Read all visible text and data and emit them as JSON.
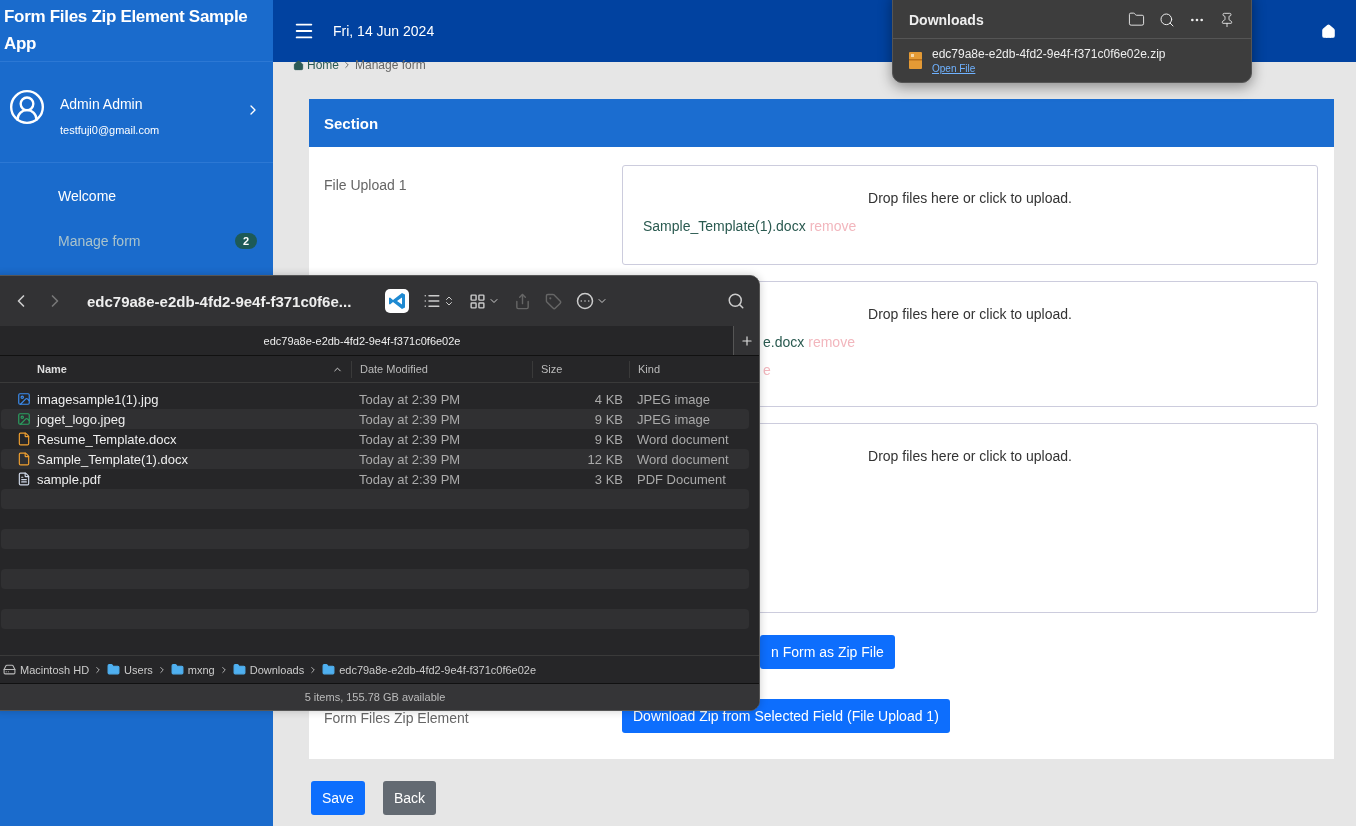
{
  "app": {
    "title": "Form Files Zip Element Sample App"
  },
  "topbar": {
    "date": "Fri, 14 Jun 2024"
  },
  "user": {
    "name": "Admin Admin",
    "email": "testfuji0@gmail.com"
  },
  "nav": [
    {
      "label": "Welcome",
      "selected": false
    },
    {
      "label": "Manage form",
      "selected": true,
      "badge": "2"
    }
  ],
  "breadcrumb": [
    "Home",
    "Manage form"
  ],
  "section": {
    "title": "Section",
    "fields": [
      {
        "kind": "upload",
        "label": "File Upload 1",
        "covered": false,
        "hint": "Drop files here or click to upload.",
        "files": [
          {
            "name": "Sample_Template(1).docx",
            "action": "remove"
          }
        ]
      },
      {
        "kind": "upload",
        "covered": true,
        "hint": "Drop files here or click to upload.",
        "files": [
          {
            "name": "e.docx",
            "action": "remove"
          },
          {
            "action": "e"
          }
        ]
      },
      {
        "kind": "upload",
        "hint": "Drop files here or click to upload."
      },
      {
        "kind": "button",
        "covered": true,
        "text": "n Form as Zip File"
      },
      {
        "kind": "button",
        "covered": false,
        "label": "Form Files Zip Element",
        "text": "Download Zip from Selected Field (File Upload 1)"
      }
    ]
  },
  "form_buttons": [
    {
      "label": "Save",
      "kind": "primary"
    },
    {
      "label": "Back",
      "kind": "secondary"
    }
  ],
  "downloads": {
    "title": "Downloads",
    "file": "edc79a8e-e2db-4fd2-9e4f-f371c0f6e02e.zip",
    "action": "Open File"
  },
  "finder": {
    "title": "edc79a8e-e2db-4fd2-9e4f-f371c0f6e...",
    "tab": "edc79a8e-e2db-4fd2-9e4f-f371c0f6e02e",
    "columns": [
      "Name",
      "Date Modified",
      "Size",
      "Kind"
    ],
    "rows": [
      {
        "kind": "image",
        "name": "imagesample1(1).jpg",
        "date": "Today at 2:39 PM",
        "size": "4 KB",
        "type_text": "JPEG image"
      },
      {
        "kind": "logo",
        "name": "joget_logo.jpeg",
        "date": "Today at 2:39 PM",
        "size": "9 KB",
        "type_text": "JPEG image"
      },
      {
        "kind": "word",
        "name": "Resume_Template.docx",
        "date": "Today at 2:39 PM",
        "size": "9 KB",
        "type_text": "Word document"
      },
      {
        "kind": "word",
        "name": "Sample_Template(1).docx",
        "date": "Today at 2:39 PM",
        "size": "12 KB",
        "type_text": "Word document"
      },
      {
        "kind": "pdf",
        "name": "sample.pdf",
        "date": "Today at 2:39 PM",
        "size": "3 KB",
        "type_text": "PDF Document"
      }
    ],
    "path": [
      {
        "kind": "disk",
        "label": "Macintosh HD"
      },
      {
        "kind": "folder",
        "label": "Users"
      },
      {
        "kind": "folder",
        "label": "mxng"
      },
      {
        "kind": "folder",
        "label": "Downloads"
      },
      {
        "kind": "folder",
        "label": "edc79a8e-e2db-4fd2-9e4f-f371c0f6e02e"
      }
    ],
    "status": "5 items, 155.78 GB available"
  }
}
